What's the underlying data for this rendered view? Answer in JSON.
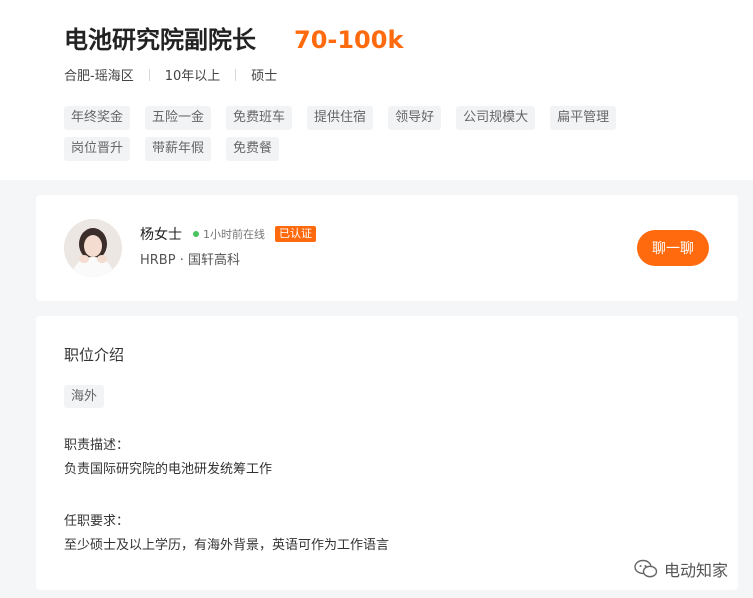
{
  "job": {
    "title": "电池研究院副院长",
    "salary": "70-100k",
    "location": "合肥-瑶海区",
    "experience": "10年以上",
    "education": "硕士"
  },
  "tags": [
    "年终奖金",
    "五险一金",
    "免费班车",
    "提供住宿",
    "领导好",
    "公司规模大",
    "扁平管理",
    "岗位晋升",
    "带薪年假",
    "免费餐"
  ],
  "recruiter": {
    "name": "杨女士",
    "online_status": "1小时前在线",
    "verified_label": "已认证",
    "position_company": "HRBP · 国轩高科",
    "chat_label": "聊一聊"
  },
  "description": {
    "section_title": "职位介绍",
    "tag": "海外",
    "duties_label": "职责描述：",
    "duties_text": "负责国际研究院的电池研发统筹工作",
    "requirements_label": "任职要求：",
    "requirements_text": "至少硕士及以上学历，有海外背景，英语可作为工作语言"
  },
  "watermark": {
    "text": "电动知家"
  },
  "colors": {
    "accent": "#ff6a0e",
    "online": "#49c35c",
    "tag_bg": "#f2f3f5"
  }
}
